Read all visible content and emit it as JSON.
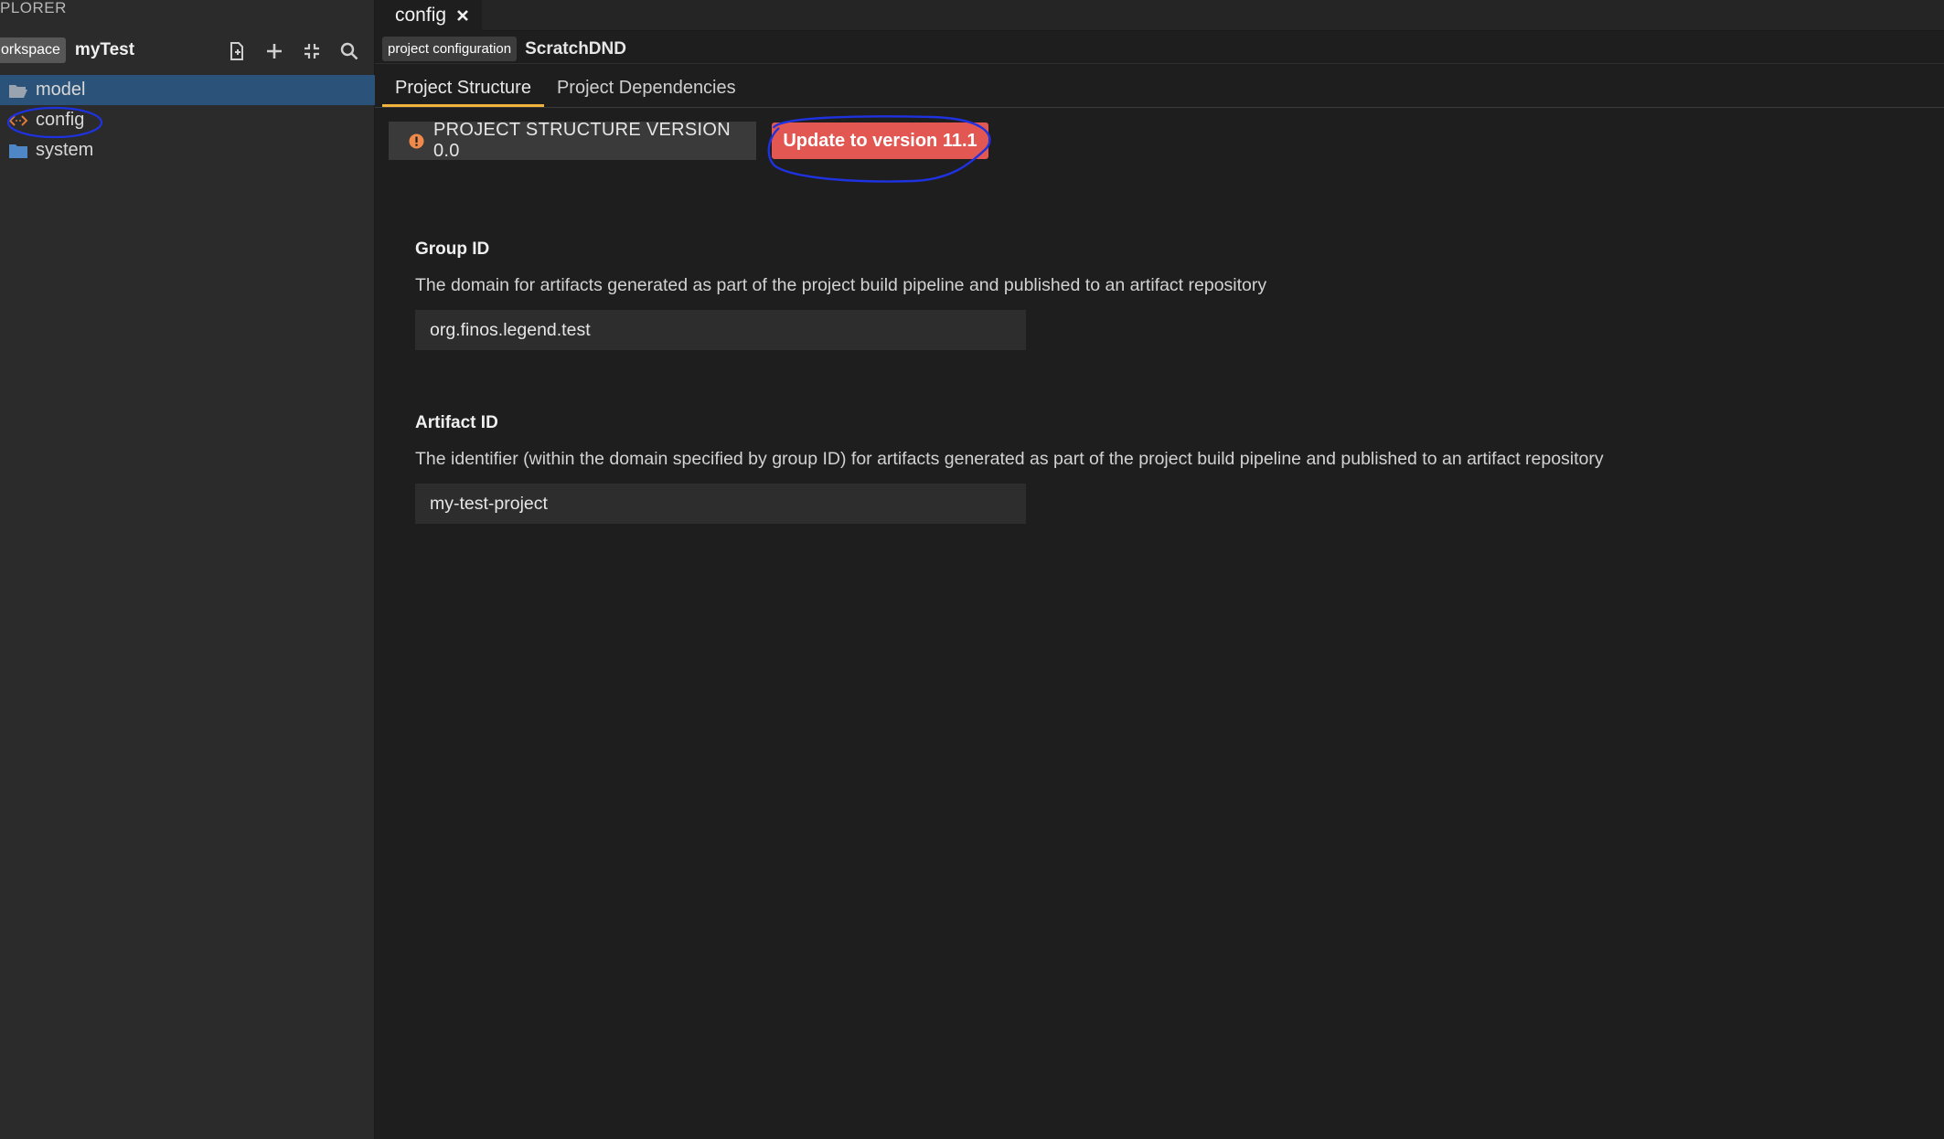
{
  "sidebar": {
    "title": "PLORER",
    "workspace_badge": "orkspace",
    "workspace_name": "myTest",
    "toolbar": {
      "icons": [
        "new-file-icon",
        "add-icon",
        "collapse-icon",
        "search-icon"
      ]
    },
    "items": [
      {
        "label": "model",
        "icon": "folder-open-icon"
      },
      {
        "label": "config",
        "icon": "code-config-icon"
      },
      {
        "label": "system",
        "icon": "folder-icon"
      }
    ]
  },
  "tab": {
    "label": "config"
  },
  "header": {
    "badge": "project configuration",
    "project_name": "ScratchDND"
  },
  "subtabs": [
    "Project Structure",
    "Project Dependencies"
  ],
  "version": {
    "label": "PROJECT STRUCTURE VERSION 0.0",
    "update_button": "Update to version 11.1"
  },
  "fields": {
    "group": {
      "title": "Group ID",
      "description": "The domain for artifacts generated as part of the project build pipeline and published to an artifact repository",
      "value": "org.finos.legend.test"
    },
    "artifact": {
      "title": "Artifact ID",
      "description": "The identifier (within the domain specified by group ID) for artifacts generated as part of the project build pipeline and published to an artifact repository",
      "value": "my-test-project"
    }
  },
  "colors": {
    "selected": "#2b5279",
    "accent_underline": "#f2b33d",
    "update_button": "#e25751",
    "annotation": "#1f32e0"
  }
}
